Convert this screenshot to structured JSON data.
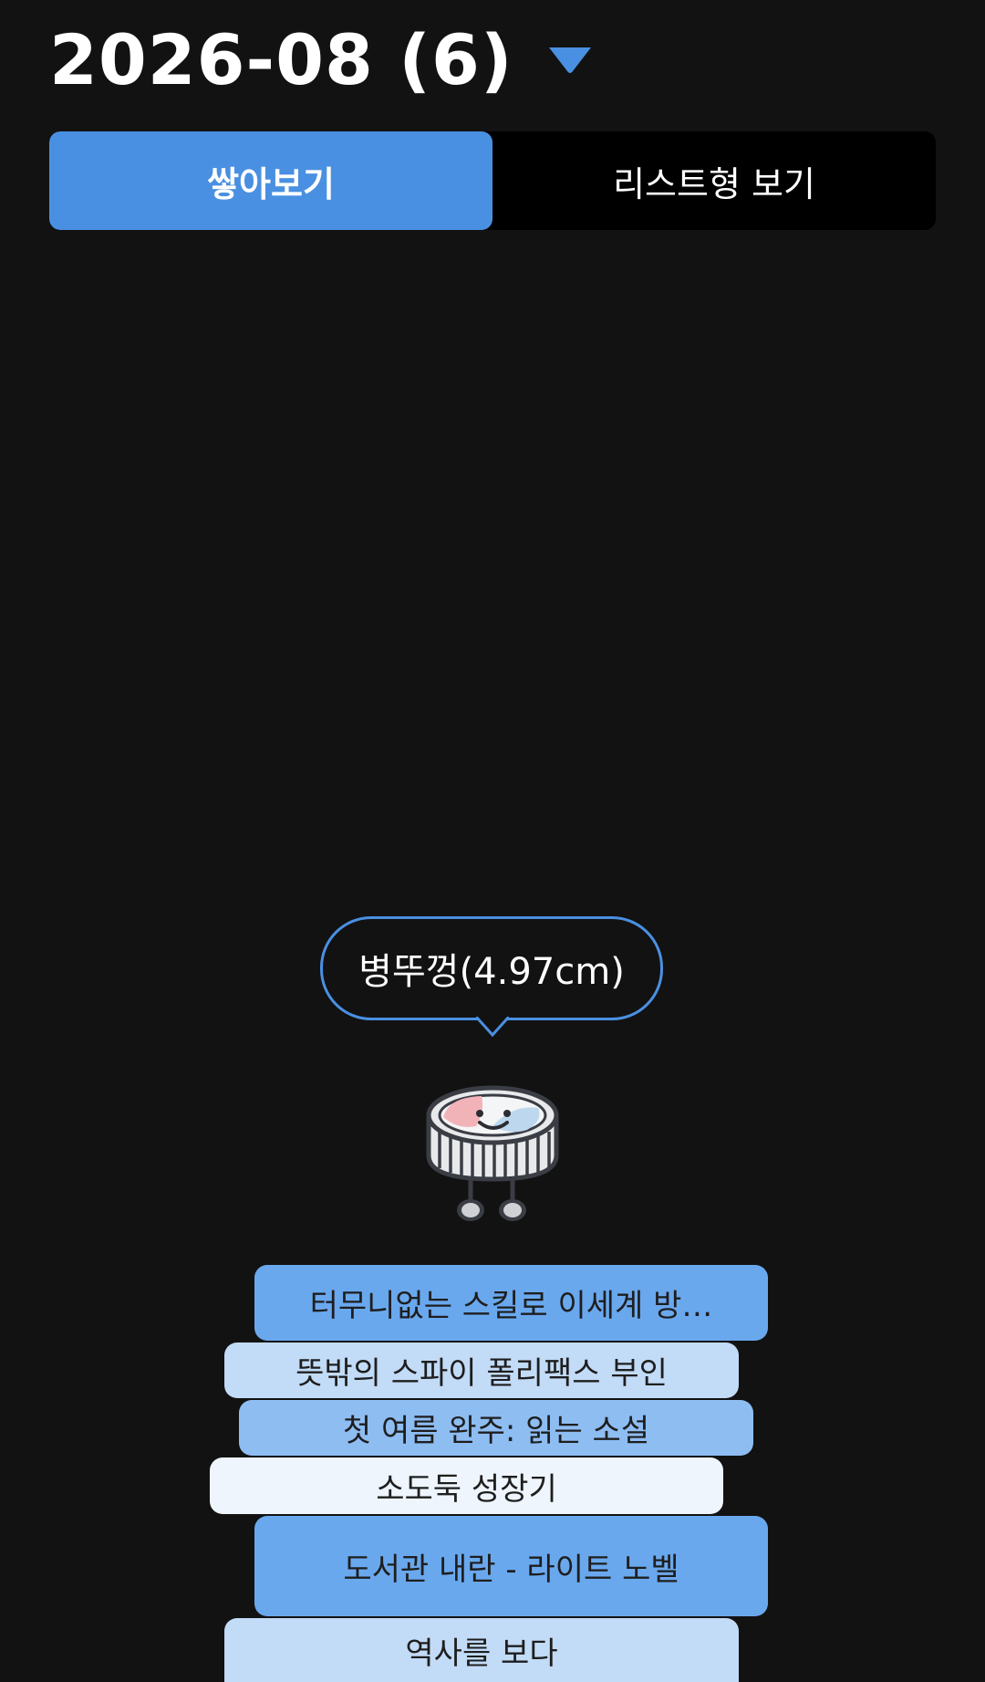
{
  "header": {
    "month_title": "2026-08 (6)"
  },
  "tabs": [
    {
      "label": "쌓아보기",
      "active": true
    },
    {
      "label": "리스트형 보기",
      "active": false
    }
  ],
  "bubble": {
    "text": "병뚜껑(4.97cm)"
  },
  "character": {
    "icon": "bottle-cap-mascot-icon"
  },
  "books": [
    {
      "title": "터무니없는 스킬로 이세계 방…",
      "color": "#6aa8ee"
    },
    {
      "title": "뜻밖의 스파이 폴리팩스 부인",
      "color": "#c2dbf7"
    },
    {
      "title": "첫 여름 완주: 읽는 소설",
      "color": "#8ebdf2"
    },
    {
      "title": "소도둑 성장기",
      "color": "#eef5fd"
    },
    {
      "title": "도서관 내란 - 라이트 노벨",
      "color": "#6aa8ee"
    },
    {
      "title": "역사를 보다",
      "color": "#c2dbf7"
    }
  ],
  "colors": {
    "background": "#121212",
    "accent": "#4a90e2"
  }
}
